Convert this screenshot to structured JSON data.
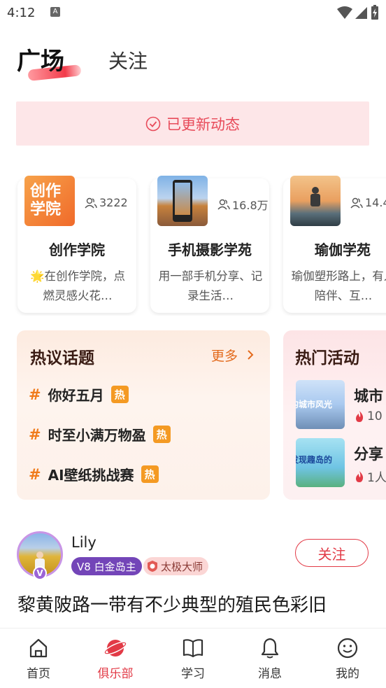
{
  "status_bar": {
    "time": "4:12",
    "notification": "A"
  },
  "tabs": {
    "active": "广场",
    "other": "关注"
  },
  "banner": {
    "text": "已更新动态"
  },
  "clubs": [
    {
      "name": "创作学院",
      "count": "3222",
      "desc": "🌟在创作学院，点燃灵感火花…",
      "thumb_text": "创作学院"
    },
    {
      "name": "手机摄影学苑",
      "count": "16.8万",
      "desc": "用一部手机分享、记录生活…"
    },
    {
      "name": "瑜伽学苑",
      "count": "14.4",
      "desc": "瑜伽塑形路上，有人陪伴、互…"
    }
  ],
  "topics": {
    "title": "热议话题",
    "more": "更多",
    "hot_label": "热",
    "items": [
      {
        "hash": "#",
        "text": "你好五月"
      },
      {
        "hash": "#",
        "text": "时至小满万物盈"
      },
      {
        "hash": "#",
        "text": "AI壁纸挑战赛"
      }
    ]
  },
  "activity": {
    "title": "热门活动",
    "items": [
      {
        "name": "城市",
        "stat": "10",
        "thumb_text": "的城市风光"
      },
      {
        "name": "分享",
        "stat": "1人",
        "thumb_text": "发现趣岛的"
      }
    ]
  },
  "post": {
    "user": "Lily",
    "level": "V8 白金岛主",
    "title_badge": "太极大师",
    "avatar_badge": "V",
    "follow": "关注",
    "text": "黎黄陂路一带有不少典型的殖民色彩旧"
  },
  "bottom_nav": [
    {
      "label": "首页",
      "icon": "home-icon"
    },
    {
      "label": "俱乐部",
      "icon": "club-planet-icon",
      "active": true
    },
    {
      "label": "学习",
      "icon": "book-icon"
    },
    {
      "label": "消息",
      "icon": "bell-icon"
    },
    {
      "label": "我的",
      "icon": "smiley-icon"
    }
  ],
  "colors": {
    "accent": "#e23a46",
    "orange": "#f07a1a",
    "banner_bg": "#fde6e8"
  }
}
